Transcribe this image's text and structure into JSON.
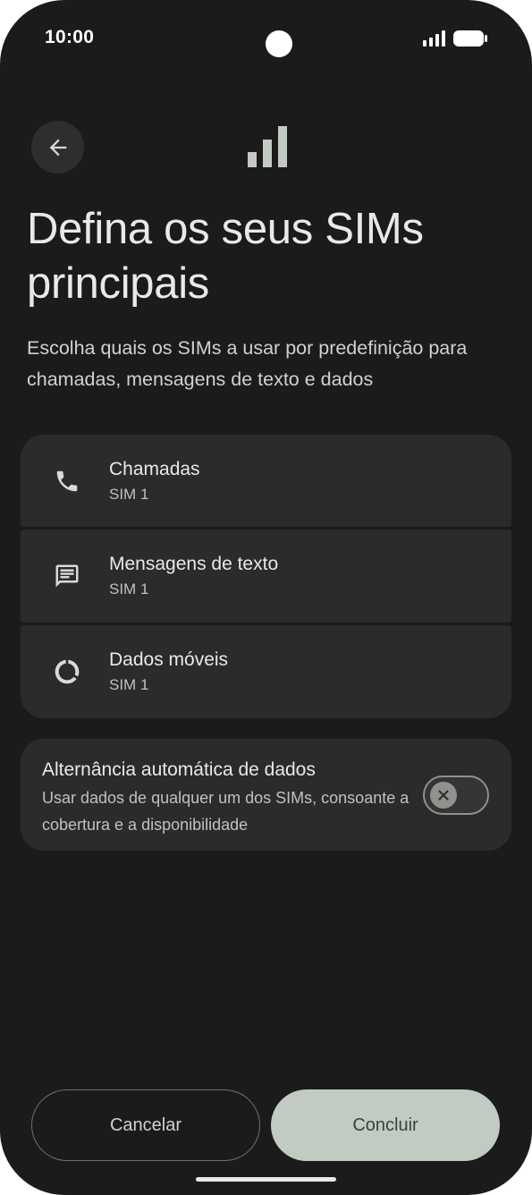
{
  "status_bar": {
    "time": "10:00"
  },
  "header": {
    "back_icon": "arrow-back-icon",
    "hero_icon": "signal-bars-icon",
    "title": "Defina os seus SIMs principais",
    "subtitle": "Escolha quais os SIMs a usar por predefinição para chamadas, mensagens de texto e dados"
  },
  "sim_settings": [
    {
      "icon": "phone-icon",
      "label": "Chamadas",
      "value": "SIM 1"
    },
    {
      "icon": "message-icon",
      "label": "Mensagens de texto",
      "value": "SIM 1"
    },
    {
      "icon": "data-usage-icon",
      "label": "Dados móveis",
      "value": "SIM 1"
    }
  ],
  "auto_switch": {
    "label": "Alternância automática de dados",
    "description": "Usar dados de qualquer um dos SIMs, consoante a cobertura e a disponibilidade",
    "enabled": false
  },
  "buttons": {
    "cancel": "Cancelar",
    "done": "Concluir"
  },
  "colors": {
    "background": "#1b1b1b",
    "card": "#2a2b2a",
    "primary_button": "#c2cbc2",
    "text": "#e9eae6"
  }
}
